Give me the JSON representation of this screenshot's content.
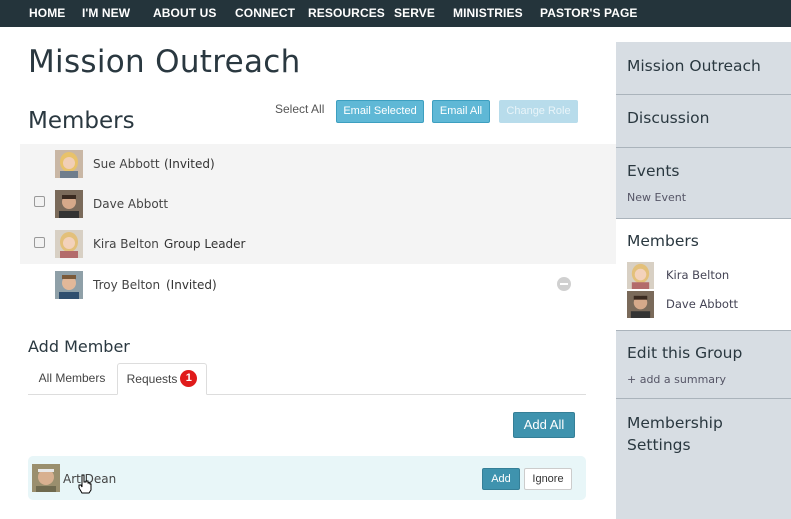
{
  "nav": {
    "items": [
      "HOME",
      "I'M NEW",
      "ABOUT US",
      "CONNECT",
      "RESOURCES",
      "SERVE",
      "MINISTRIES",
      "PASTOR'S PAGE"
    ]
  },
  "page": {
    "title": "Mission Outreach",
    "members_heading": "Members",
    "select_all": "Select All",
    "email_selected": "Email Selected",
    "email_all": "Email All",
    "change_role": "Change Role"
  },
  "members": [
    {
      "name": "Sue Abbott",
      "status": "(Invited)",
      "checkbox": false
    },
    {
      "name": "Dave Abbott",
      "status": "",
      "checkbox": true
    },
    {
      "name": "Kira Belton",
      "status": "Group Leader",
      "checkbox": true
    },
    {
      "name": "Troy Belton",
      "status": "(Invited)",
      "checkbox": false
    }
  ],
  "add_member": {
    "heading": "Add Member",
    "tabs": [
      {
        "label": "All Members"
      },
      {
        "label": "Requests",
        "badge": "1"
      }
    ],
    "add_all": "Add All",
    "requests": [
      {
        "name": "Art Dean",
        "add": "Add",
        "ignore": "Ignore"
      }
    ]
  },
  "sidebar": {
    "mission_outreach": "Mission Outreach",
    "discussion": "Discussion",
    "events": "Events",
    "new_event": "New Event",
    "members": "Members",
    "member_list": [
      "Kira Belton",
      "Dave Abbott"
    ],
    "edit_group": "Edit this Group",
    "add_summary": "+ add a summary",
    "membership_settings_line1": "Membership",
    "membership_settings_line2": "Settings"
  },
  "colors": {
    "nav_bg": "#24343b",
    "accent": "#3f93ae",
    "sidebar_bg": "#d7dde3",
    "badge": "#e01b1b"
  }
}
